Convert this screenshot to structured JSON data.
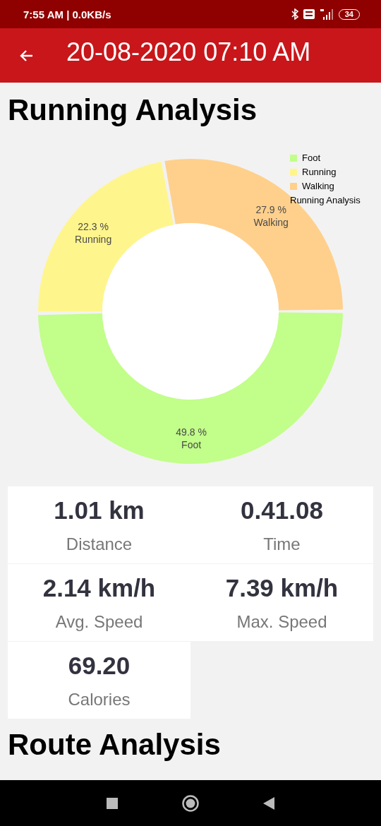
{
  "status_bar": {
    "time": "7:55 AM | 0.0KB/s",
    "battery": "34"
  },
  "app_bar": {
    "title": "20-08-2020 07:10 AM"
  },
  "running_analysis": {
    "heading": "Running Analysis",
    "chart_data": {
      "type": "donut",
      "categories": [
        "Foot",
        "Running",
        "Walking"
      ],
      "values": [
        49.8,
        22.3,
        27.9
      ],
      "colors": [
        "#c2fe8a",
        "#fff58d",
        "#ffd08c"
      ],
      "legend": {
        "title": "Running Analysis"
      },
      "data_labels": true,
      "value_labels": [
        "49.8 %",
        "22.3 %",
        "27.9 %"
      ]
    }
  },
  "stats": [
    {
      "value": "1.01 km",
      "label": "Distance"
    },
    {
      "value": "0.41.08",
      "label": "Time"
    },
    {
      "value": "2.14 km/h",
      "label": "Avg. Speed"
    },
    {
      "value": "7.39 km/h",
      "label": "Max. Speed"
    },
    {
      "value": "69.20",
      "label": "Calories"
    }
  ],
  "route_analysis": {
    "heading": "Route Analysis"
  }
}
